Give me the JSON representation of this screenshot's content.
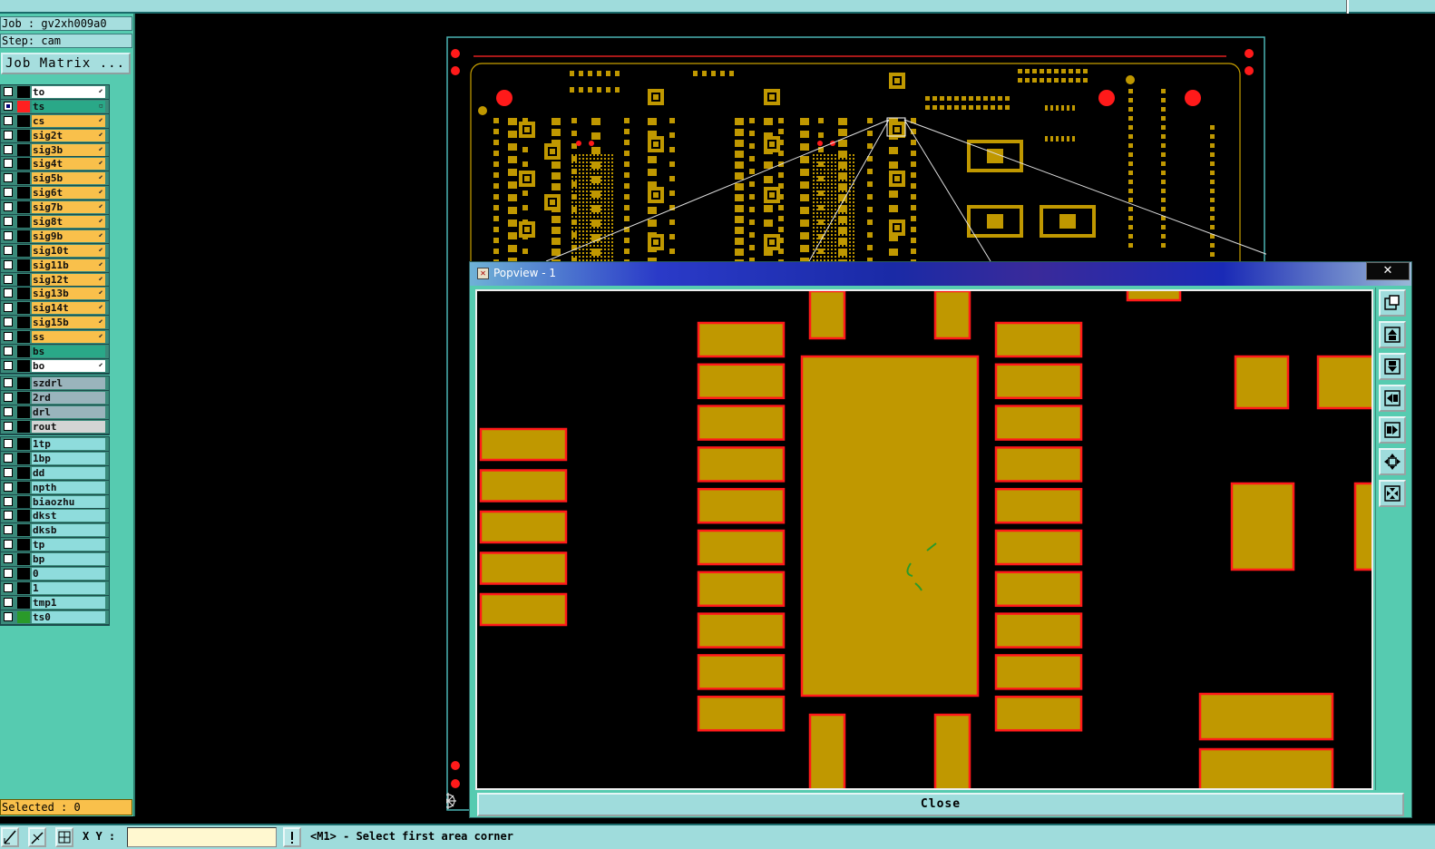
{
  "job_label": "Job : gv2xh009a0",
  "step_label": "Step: cam",
  "job_matrix_button": "Job Matrix ...",
  "layer_groups": [
    [
      {
        "name": "to",
        "bg": "#ffffff",
        "swatch": "#000000",
        "arrow": "⬋"
      },
      {
        "name": "ts",
        "bg": "#2aa888",
        "swatch": "#ff2020",
        "arrow": "▫",
        "active": true
      },
      {
        "name": "cs",
        "bg": "#f9c04b",
        "swatch": "#000000",
        "arrow": "⬋"
      },
      {
        "name": "sig2t",
        "bg": "#f9c04b",
        "swatch": "#000000",
        "arrow": "⬋"
      },
      {
        "name": "sig3b",
        "bg": "#f9c04b",
        "swatch": "#000000",
        "arrow": "⬋"
      },
      {
        "name": "sig4t",
        "bg": "#f9c04b",
        "swatch": "#000000",
        "arrow": "⬋"
      },
      {
        "name": "sig5b",
        "bg": "#f9c04b",
        "swatch": "#000000",
        "arrow": "⬋"
      },
      {
        "name": "sig6t",
        "bg": "#f9c04b",
        "swatch": "#000000",
        "arrow": "⬋"
      },
      {
        "name": "sig7b",
        "bg": "#f9c04b",
        "swatch": "#000000",
        "arrow": "⬋"
      },
      {
        "name": "sig8t",
        "bg": "#f9c04b",
        "swatch": "#000000",
        "arrow": "⬋"
      },
      {
        "name": "sig9b",
        "bg": "#f9c04b",
        "swatch": "#000000",
        "arrow": "⬋"
      },
      {
        "name": "sig10t",
        "bg": "#f9c04b",
        "swatch": "#000000",
        "arrow": "⬋"
      },
      {
        "name": "sig11b",
        "bg": "#f9c04b",
        "swatch": "#000000",
        "arrow": "⬋"
      },
      {
        "name": "sig12t",
        "bg": "#f9c04b",
        "swatch": "#000000",
        "arrow": "⬋"
      },
      {
        "name": "sig13b",
        "bg": "#f9c04b",
        "swatch": "#000000",
        "arrow": "⬋"
      },
      {
        "name": "sig14t",
        "bg": "#f9c04b",
        "swatch": "#000000",
        "arrow": "⬋"
      },
      {
        "name": "sig15b",
        "bg": "#f9c04b",
        "swatch": "#000000",
        "arrow": "⬋"
      },
      {
        "name": "ss",
        "bg": "#f9c04b",
        "swatch": "#000000",
        "arrow": "⬋"
      },
      {
        "name": "bs",
        "bg": "#2aa888",
        "swatch": "#000000",
        "arrow": ""
      },
      {
        "name": "bo",
        "bg": "#ffffff",
        "swatch": "#000000",
        "arrow": "⬋"
      }
    ],
    [
      {
        "name": "szdrl",
        "bg": "#9ab4bc",
        "swatch": "#000000",
        "arrow": ""
      },
      {
        "name": "2rd",
        "bg": "#9ab4bc",
        "swatch": "#000000",
        "arrow": ""
      },
      {
        "name": "drl",
        "bg": "#9ab4bc",
        "swatch": "#000000",
        "arrow": ""
      },
      {
        "name": "rout",
        "bg": "#d4d4d4",
        "swatch": "#000000",
        "arrow": ""
      }
    ],
    [
      {
        "name": "1tp",
        "bg": "#8edcdc",
        "swatch": "#000000",
        "arrow": ""
      },
      {
        "name": "1bp",
        "bg": "#8edcdc",
        "swatch": "#000000",
        "arrow": ""
      },
      {
        "name": "dd",
        "bg": "#8edcdc",
        "swatch": "#000000",
        "arrow": ""
      },
      {
        "name": "npth",
        "bg": "#8edcdc",
        "swatch": "#000000",
        "arrow": ""
      },
      {
        "name": "biaozhu",
        "bg": "#8edcdc",
        "swatch": "#000000",
        "arrow": ""
      },
      {
        "name": "dkst",
        "bg": "#8edcdc",
        "swatch": "#000000",
        "arrow": ""
      },
      {
        "name": "dksb",
        "bg": "#8edcdc",
        "swatch": "#000000",
        "arrow": ""
      },
      {
        "name": "tp",
        "bg": "#8edcdc",
        "swatch": "#000000",
        "arrow": ""
      },
      {
        "name": "bp",
        "bg": "#8edcdc",
        "swatch": "#000000",
        "arrow": ""
      },
      {
        "name": "0",
        "bg": "#8edcdc",
        "swatch": "#000000",
        "arrow": ""
      },
      {
        "name": "1",
        "bg": "#8edcdc",
        "swatch": "#000000",
        "arrow": ""
      },
      {
        "name": "tmp1",
        "bg": "#8edcdc",
        "swatch": "#000000",
        "arrow": ""
      },
      {
        "name": "ts0",
        "bg": "#8edcdc",
        "swatch": "#2a9a2a",
        "arrow": ""
      }
    ]
  ],
  "selected_label": "Selected : 0",
  "xy_label": "X Y :",
  "xy_value": "",
  "status_message": "<M1> - Select first area corner",
  "popview": {
    "title": "Popview - 1",
    "close_x": "✕",
    "close_button": "Close"
  },
  "colors": {
    "pad_fill": "#c09800",
    "pad_outline": "#ff1a1a",
    "panel": "#56cbb0",
    "layer_board": "#f9c04b"
  }
}
